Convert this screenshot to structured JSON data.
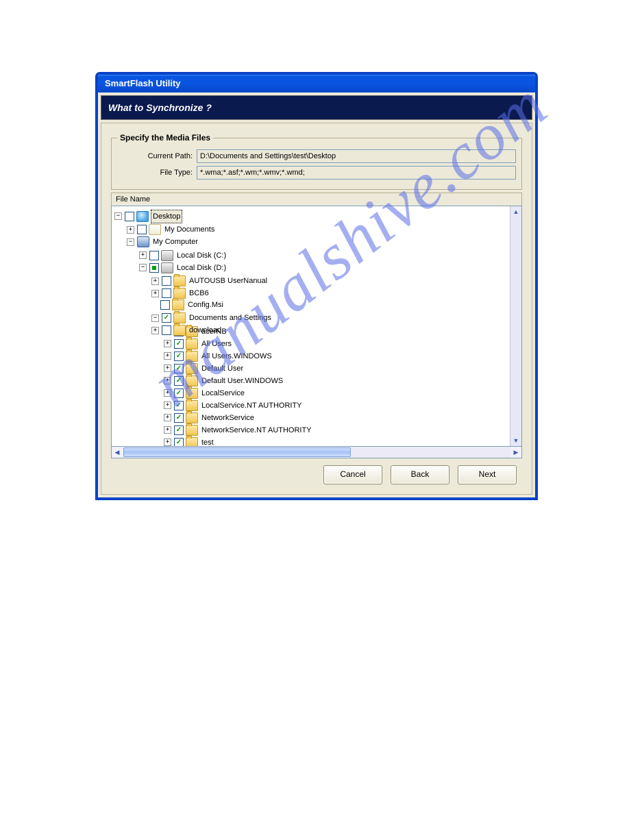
{
  "watermark": "manualshive.com",
  "window": {
    "title": "SmartFlash Utility",
    "subheader": "What to Synchronize ?"
  },
  "fieldset": {
    "legend": "Specify the Media Files",
    "currentPathLabel": "Current Path:",
    "currentPathValue": "D:\\Documents and Settings\\test\\Desktop",
    "fileTypeLabel": "File Type:",
    "fileTypeValue": "*.wma;*.asf;*.wm;*.wmv;*.wmd;"
  },
  "listHeader": "File Name",
  "treeLabels": {
    "desktop": "Desktop",
    "mydocs": "My Documents",
    "mycomp": "My Computer",
    "diskC": "Local Disk (C:)",
    "diskD": "Local Disk (D:)",
    "autousb": "AUTOUSB UserNanual",
    "bcb6": "BCB6",
    "configmsi": "Config.Msi",
    "das": "Documents and Settings",
    "acernb": "acerNB",
    "allusers": "All Users",
    "alluserswin": "All Users.WINDOWS",
    "defuser": "Default User",
    "defuserwin": "Default User.WINDOWS",
    "localsvc": "LocalService",
    "localsvcnt": "LocalService.NT AUTHORITY",
    "netsvc": "NetworkService",
    "netsvcnt": "NetworkService.NT AUTHORITY",
    "test": "test",
    "download": "download"
  },
  "buttons": {
    "cancel": "Cancel",
    "back": "Back",
    "next": "Next"
  }
}
